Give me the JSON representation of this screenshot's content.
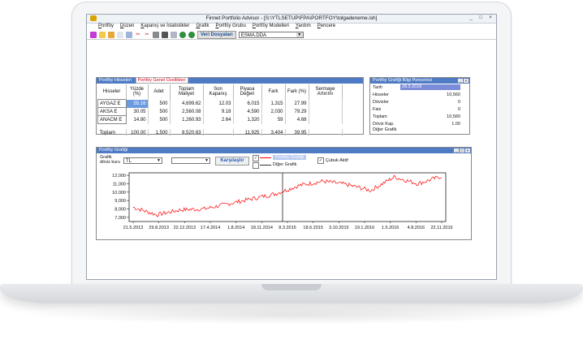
{
  "window": {
    "title": "Finnet Portfolio Advisor - [S:\\YTLSETUP\\FPA\\PORTFOY\\tolgadeneme.ish]",
    "controls": [
      "_",
      "□",
      "×"
    ]
  },
  "menu": [
    "Portföy",
    "Düzen",
    "Kapanış ve İstatistikler",
    "Grafik",
    "Portföy Grubu",
    "Portföy Modelleri",
    "Yardım",
    "Pencere"
  ],
  "toolbar": {
    "file_label": "Veri Dosyaları",
    "combo_value": "ESMA.DDA"
  },
  "holdings_panel": {
    "title": "Portföy Hisseleri",
    "tab": "Portföy Genel Özellikleri",
    "headers": [
      "Hisseler",
      "Yüzde (%)",
      "Adet",
      "Toplam Maliyet",
      "Son Kapanış",
      "Piyasa Değeri",
      "Fark",
      "Fark (%)",
      "Sermaye Artırımı"
    ],
    "rows": [
      [
        "AYGAZ E",
        "55.16",
        "500",
        "4,699.62",
        "12.03",
        "6,015",
        "1,315",
        "27.99",
        ""
      ],
      [
        "AKSA E",
        "30.05",
        "500",
        "2,560.08",
        "9.18",
        "4,590",
        "2,030",
        "79.29",
        ""
      ],
      [
        "ANACM E",
        "14.80",
        "500",
        "1,260.93",
        "2.64",
        "1,320",
        "59",
        "4.68",
        ""
      ]
    ],
    "total": [
      "Toplam",
      "100.00",
      "1,500",
      "8,520.63",
      "",
      "11,925",
      "3,404",
      "39.95",
      ""
    ]
  },
  "info_panel": {
    "title": "Portföy Grafiği Bilgi Penceresi",
    "date_label": "Tarih",
    "date_value": "28.5.2016",
    "rows": [
      {
        "label": "Hisseler",
        "value": "10,560"
      },
      {
        "label": "Dövizler",
        "value": "0"
      },
      {
        "label": "Faiz",
        "value": "0"
      },
      {
        "label": "Toplam",
        "value": "10,560"
      },
      {
        "label": "Döviz Kap.",
        "value": "1.00"
      },
      {
        "label": "Diğer Grafik",
        "value": ""
      }
    ]
  },
  "chart_panel": {
    "title": "Portföy Grafiği",
    "currency_label": "Grafik döviz kuru",
    "currency_value": "TL",
    "second_select": "",
    "compare_button": "Karşılaştır",
    "legend_portfolio": "Portföy Grafiği",
    "legend_other": "Diğer Grafik",
    "bar_active": "Çubuk Aktif"
  },
  "chart_data": {
    "type": "line",
    "x": [
      "21.5.2013",
      "29.8.2013",
      "22.12.2013",
      "17.4.2014",
      "1.8.2014",
      "18.11.2014",
      "8.3.2015",
      "18.6.2015",
      "3.10.2015",
      "19.1.2016",
      "1.5.2016",
      "4.8.2016",
      "22.11.2016"
    ],
    "series": [
      {
        "color": "#ff0000",
        "values": [
          8200,
          7300,
          7900,
          8000,
          8600,
          9200,
          9800,
          10800,
          11300,
          10900,
          10200,
          11800,
          11000,
          11900
        ]
      }
    ],
    "yticks": [
      "12,000",
      "11,000",
      "10,000",
      "9,000",
      "8,000",
      "7,000"
    ],
    "ylim": [
      6500,
      12300
    ],
    "marker_date": "8.3.2015",
    "grid": false
  },
  "colors": {
    "panel_title": "#4f7bc4",
    "line": "#ff0000",
    "highlight": "#6a9ae0"
  }
}
